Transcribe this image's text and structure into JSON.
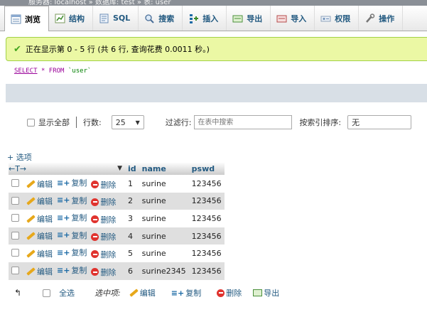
{
  "breadcrumb": {
    "text": "服务器: localhost » 数据库: test » 表: user"
  },
  "tabs": [
    {
      "label": "浏览",
      "icon": "browse-icon",
      "active": true
    },
    {
      "label": "结构",
      "icon": "structure-icon"
    },
    {
      "label": "SQL",
      "icon": "sql-icon"
    },
    {
      "label": "搜索",
      "icon": "search-icon"
    },
    {
      "label": "插入",
      "icon": "insert-icon"
    },
    {
      "label": "导出",
      "icon": "export-icon"
    },
    {
      "label": "导入",
      "icon": "import-icon"
    },
    {
      "label": "权限",
      "icon": "privileges-icon"
    },
    {
      "label": "操作",
      "icon": "operations-icon"
    }
  ],
  "message": {
    "text": "正在显示第 0 - 5 行 (共 6 行, 查询花费 0.0011 秒。)",
    "color": "#42a51e"
  },
  "query": {
    "select": "SELECT",
    "star": "*",
    "from": "FROM",
    "table": "`user`"
  },
  "nav": {
    "show_all": "显示全部",
    "rows_label": "行数:",
    "rows_value": "25",
    "filter_label": "过滤行:",
    "filter_placeholder": "在表中搜索",
    "sort_label": "按索引排序:",
    "sort_value": "无"
  },
  "options_link": "+ 选项",
  "table": {
    "headers": [
      "id",
      "name",
      "pswd"
    ],
    "actions": {
      "edit": "编辑",
      "copy": "复制",
      "delete": "删除"
    },
    "rows": [
      {
        "id": "1",
        "name": "surine",
        "pswd": "123456"
      },
      {
        "id": "2",
        "name": "surine",
        "pswd": "123456"
      },
      {
        "id": "3",
        "name": "surine",
        "pswd": "123456"
      },
      {
        "id": "4",
        "name": "surine",
        "pswd": "123456"
      },
      {
        "id": "5",
        "name": "surine",
        "pswd": "123456"
      },
      {
        "id": "6",
        "name": "surine2345",
        "pswd": "123456"
      }
    ]
  },
  "bottom": {
    "select_all": "全选",
    "with_selected": "选中项:",
    "edit": "编辑",
    "copy": "复制",
    "delete": "删除",
    "export": "导出"
  },
  "colors": {
    "link": "#235a81",
    "success_bg": "#ebf8a4",
    "row_alt": "#dfdfdf",
    "delete": "#e0332e"
  }
}
